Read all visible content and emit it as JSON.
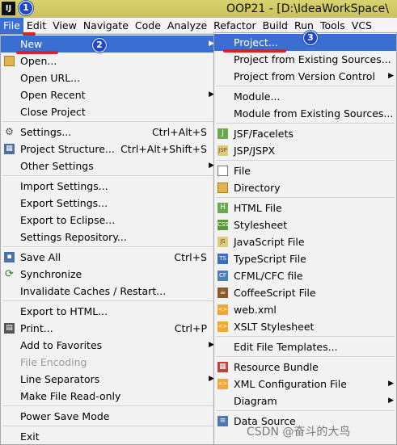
{
  "window": {
    "title": "OOP21 - [D:\\IdeaWorkSpace\\"
  },
  "menubar": [
    "File",
    "Edit",
    "View",
    "Navigate",
    "Code",
    "Analyze",
    "Refactor",
    "Build",
    "Run",
    "Tools",
    "VCS"
  ],
  "file_menu": {
    "items": [
      {
        "label": "New",
        "submenu": true
      },
      {
        "label": "Open...",
        "icon": "folder-icon"
      },
      {
        "label": "Open URL..."
      },
      {
        "label": "Open Recent",
        "submenu": true
      },
      {
        "label": "Close Project"
      },
      {
        "label": "Settings...",
        "shortcut": "Ctrl+Alt+S",
        "icon": "gear-icon"
      },
      {
        "label": "Project Structure...",
        "shortcut": "Ctrl+Alt+Shift+S",
        "icon": "project-structure-icon"
      },
      {
        "label": "Other Settings",
        "submenu": true
      },
      {
        "label": "Import Settings..."
      },
      {
        "label": "Export Settings..."
      },
      {
        "label": "Export to Eclipse..."
      },
      {
        "label": "Settings Repository..."
      },
      {
        "label": "Save All",
        "shortcut": "Ctrl+S",
        "icon": "save-icon"
      },
      {
        "label": "Synchronize",
        "icon": "sync-icon"
      },
      {
        "label": "Invalidate Caches / Restart..."
      },
      {
        "label": "Export to HTML..."
      },
      {
        "label": "Print...",
        "shortcut": "Ctrl+P",
        "icon": "print-icon"
      },
      {
        "label": "Add to Favorites",
        "submenu": true
      },
      {
        "label": "File Encoding",
        "disabled": true
      },
      {
        "label": "Line Separators",
        "submenu": true
      },
      {
        "label": "Make File Read-only"
      },
      {
        "label": "Power Save Mode"
      },
      {
        "label": "Exit"
      }
    ]
  },
  "new_menu": {
    "items": [
      {
        "label": "Project..."
      },
      {
        "label": "Project from Existing Sources..."
      },
      {
        "label": "Project from Version Control",
        "submenu": true
      },
      {
        "label": "Module..."
      },
      {
        "label": "Module from Existing Sources..."
      },
      {
        "label": "JSF/Facelets",
        "icon": "jsf-icon"
      },
      {
        "label": "JSP/JSPX",
        "icon": "jsp-icon"
      },
      {
        "label": "File",
        "icon": "file-icon"
      },
      {
        "label": "Directory",
        "icon": "folder-icon"
      },
      {
        "label": "HTML File",
        "icon": "html-icon"
      },
      {
        "label": "Stylesheet",
        "icon": "css-icon"
      },
      {
        "label": "JavaScript File",
        "icon": "javascript-icon"
      },
      {
        "label": "TypeScript File",
        "icon": "typescript-icon"
      },
      {
        "label": "CFML/CFC file",
        "icon": "cfml-icon"
      },
      {
        "label": "CoffeeScript File",
        "icon": "coffeescript-icon"
      },
      {
        "label": "web.xml",
        "icon": "xml-icon"
      },
      {
        "label": "XSLT Stylesheet",
        "icon": "xslt-icon"
      },
      {
        "label": "Edit File Templates..."
      },
      {
        "label": "Resource Bundle",
        "icon": "resource-bundle-icon"
      },
      {
        "label": "XML Configuration File",
        "submenu": true,
        "icon": "xml-config-icon"
      },
      {
        "label": "Diagram",
        "submenu": true
      },
      {
        "label": "Data Source",
        "icon": "data-source-icon"
      }
    ]
  },
  "annotations": {
    "badge1": "1",
    "badge2": "2",
    "badge3": "3"
  },
  "watermark": "CSDN @奋斗的大鸟",
  "colors": {
    "highlight": "#3a6ed3",
    "badge": "#1f49c7",
    "marker": "#e02020"
  }
}
